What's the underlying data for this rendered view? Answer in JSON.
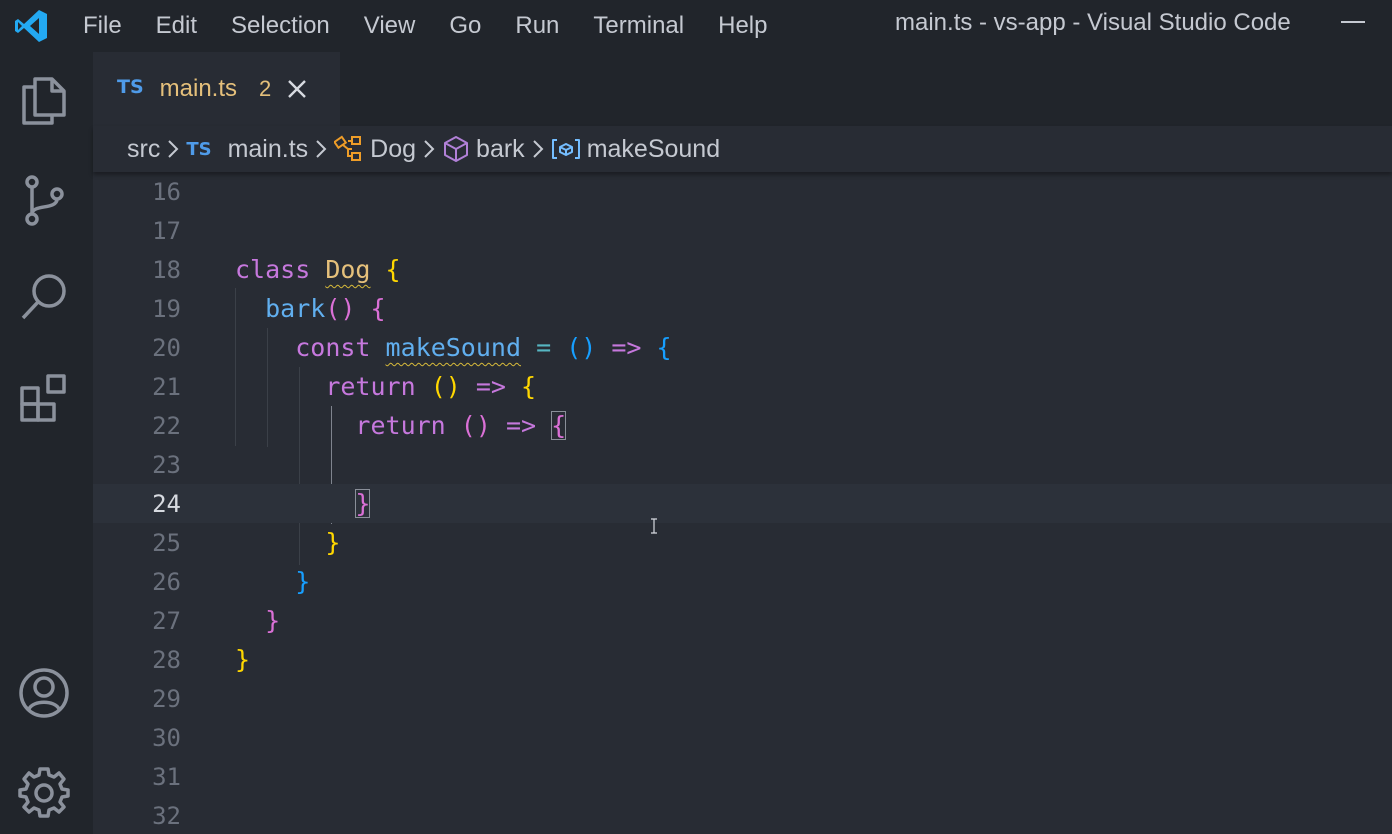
{
  "titlebar": {
    "logo_icon": "vscode-logo-icon",
    "menu": [
      "File",
      "Edit",
      "Selection",
      "View",
      "Go",
      "Run",
      "Terminal",
      "Help"
    ],
    "window_title": "main.ts - vs-app - Visual Studio Code"
  },
  "activitybar": {
    "items": [
      "explorer-icon",
      "source-control-icon",
      "search-icon",
      "extensions-icon",
      "accounts-icon",
      "settings-gear-icon"
    ]
  },
  "tab": {
    "lang_badge": "TS",
    "filename": "main.ts",
    "problem_count": "2"
  },
  "breadcrumbs": {
    "folder": "src",
    "file_badge": "TS",
    "file": "main.ts",
    "class": "Dog",
    "method": "bark",
    "variable": "makeSound"
  },
  "editor": {
    "current_line": "24",
    "line_numbers": [
      "16",
      "17",
      "18",
      "19",
      "20",
      "21",
      "22",
      "23",
      "24",
      "25",
      "26",
      "27",
      "28",
      "29",
      "30",
      "31",
      "32"
    ],
    "tokens": {
      "l18_class": "class",
      "l18_name": "Dog",
      "l18_brace": "{",
      "l19_fn": "bark",
      "l19_parens": "()",
      "l19_brace": "{",
      "l20_const": "const",
      "l20_var": "makeSound",
      "l20_eq": "=",
      "l20_parens": "()",
      "l20_arrow": "=>",
      "l20_brace": "{",
      "l21_return": "return",
      "l21_parens": "()",
      "l21_arrow": "=>",
      "l21_brace": "{",
      "l22_return": "return",
      "l22_parens": "()",
      "l22_arrow": "=>",
      "l22_brace": "{",
      "l24_brace": "}",
      "l25_brace": "}",
      "l26_brace": "}",
      "l27_brace": "}",
      "l28_brace": "}"
    }
  },
  "colors": {
    "keyword": "#c678dd",
    "class_name": "#e5c07b",
    "function": "#61afef",
    "operator": "#56b6c2",
    "bracket_level_1": "#ffd700",
    "bracket_level_2": "#da70d6",
    "bracket_level_3": "#179fff",
    "warning_squiggle": "#d7ba3a"
  }
}
